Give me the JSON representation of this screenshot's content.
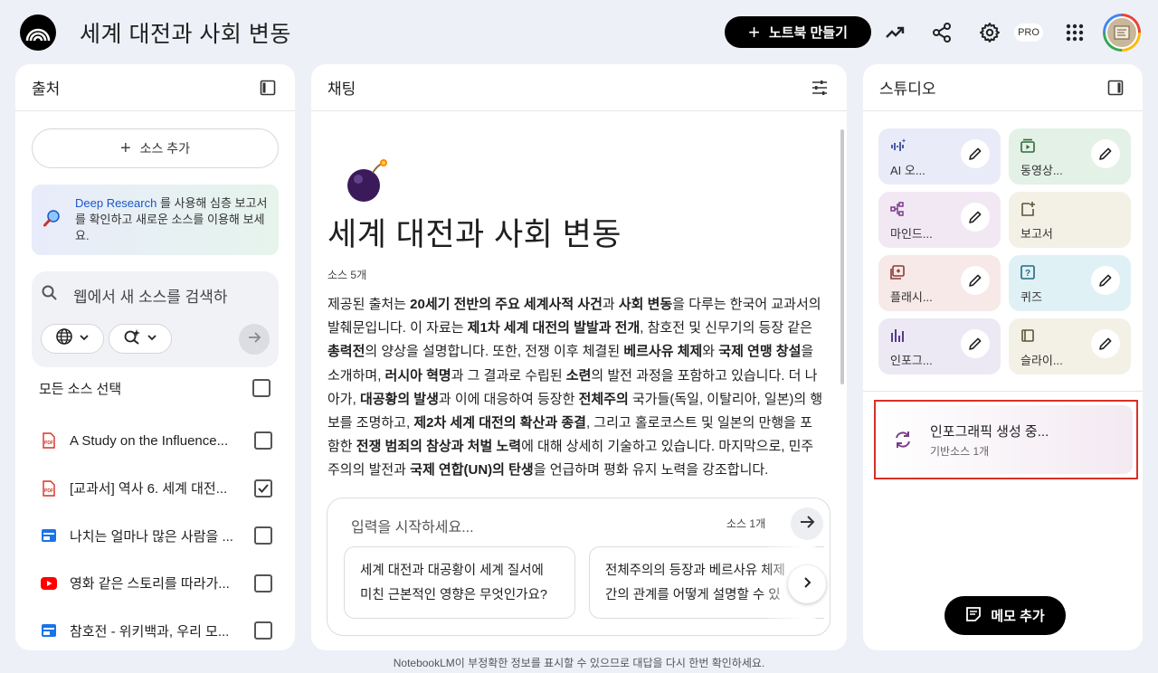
{
  "header": {
    "title": "세계 대전과 사회 변동",
    "create_notebook_label": "노트북 만들기",
    "pro_badge": "PRO"
  },
  "sources": {
    "title": "출처",
    "add_source_label": "소스 추가",
    "deep_research_link": "Deep Research",
    "deep_research_text": " 를 사용해 심층 보고서를 확인하고 새로운 소스를 이용해 보세요.",
    "search_placeholder": "웹에서 새 소스를 검색하",
    "select_all_label": "모든 소스 선택",
    "items": [
      {
        "label": "A Study on the Influence...",
        "type": "pdf",
        "checked": false
      },
      {
        "label": "[교과서] 역사 6. 세계 대전...",
        "type": "pdf",
        "checked": true
      },
      {
        "label": "나치는 얼마나 많은 사람을 ...",
        "type": "web",
        "checked": false
      },
      {
        "label": "영화 같은 스토리를 따라가...",
        "type": "youtube",
        "checked": false
      },
      {
        "label": "참호전 - 위키백과, 우리 모...",
        "type": "web",
        "checked": false
      }
    ]
  },
  "chat": {
    "title": "채팅",
    "notebook_title": "세계 대전과 사회 변동",
    "source_count": "소스 5개",
    "summary_segments": [
      {
        "t": "제공된 출처는 ",
        "b": false
      },
      {
        "t": "20세기 전반의 주요 세계사적 사건",
        "b": true
      },
      {
        "t": "과 ",
        "b": false
      },
      {
        "t": "사회 변동",
        "b": true
      },
      {
        "t": "을 다루는 한국어 교과서의 발췌문입니다. 이 자료는 ",
        "b": false
      },
      {
        "t": "제1차 세계 대전의 발발과 전개",
        "b": true
      },
      {
        "t": ", 참호전 및 신무기의 등장 같은 ",
        "b": false
      },
      {
        "t": "총력전",
        "b": true
      },
      {
        "t": "의 양상을 설명합니다. 또한, 전쟁 이후 체결된 ",
        "b": false
      },
      {
        "t": "베르사유 체제",
        "b": true
      },
      {
        "t": "와 ",
        "b": false
      },
      {
        "t": "국제 연맹 창설",
        "b": true
      },
      {
        "t": "을 소개하며, ",
        "b": false
      },
      {
        "t": "러시아 혁명",
        "b": true
      },
      {
        "t": "과 그 결과로 수립된 ",
        "b": false
      },
      {
        "t": "소련",
        "b": true
      },
      {
        "t": "의 발전 과정을 포함하고 있습니다. 더 나아가, ",
        "b": false
      },
      {
        "t": "대공황의 발생",
        "b": true
      },
      {
        "t": "과 이에 대응하여 등장한 ",
        "b": false
      },
      {
        "t": "전체주의",
        "b": true
      },
      {
        "t": " 국가들(독일, 이탈리아, 일본)의 행보를 조명하고, ",
        "b": false
      },
      {
        "t": "제2차 세계 대전의 확산과 종결",
        "b": true
      },
      {
        "t": ", 그리고 홀로코스트 및 일본의 만행을 포함한 ",
        "b": false
      },
      {
        "t": "전쟁 범죄의 참상과 처벌 노력",
        "b": true
      },
      {
        "t": "에 대해 상세히 기술하고 있습니다. 마지막으로, 민주주의의 발전과 ",
        "b": false
      },
      {
        "t": "국제 연합(UN)의 탄생",
        "b": true
      },
      {
        "t": "을 언급하며 평화 유지 노력을 강조합니다.",
        "b": false
      }
    ],
    "input_placeholder": "입력을 시작하세요...",
    "input_source_count": "소스 1개",
    "suggestions": [
      {
        "line1": "세계 대전과 대공황이 세계 질서에",
        "line2": "미친 근본적인 영향은 무엇인가요?"
      },
      {
        "line1": "전체주의의 등장과 베르사유 체제",
        "line2": "간의 관계를 어떻게 설명할 수 있"
      }
    ]
  },
  "studio": {
    "title": "스튜디오",
    "tiles": [
      {
        "label": "AI 오...",
        "icon": "audio-icon",
        "color": "#e9ebf8",
        "icon_color": "#3a4a9a"
      },
      {
        "label": "동영상...",
        "icon": "video-icon",
        "color": "#e3f1e7",
        "icon_color": "#2f6a3c"
      },
      {
        "label": "마인드...",
        "icon": "mindmap-icon",
        "color": "#f1e8f4",
        "icon_color": "#7a3c8a"
      },
      {
        "label": "보고서",
        "icon": "report-icon",
        "color": "#f3f1e6",
        "icon_color": "#5b5537"
      },
      {
        "label": "플래시...",
        "icon": "flashcard-icon",
        "color": "#f6e9e8",
        "icon_color": "#8a3a33"
      },
      {
        "label": "퀴즈",
        "icon": "quiz-icon",
        "color": "#e0f1f6",
        "icon_color": "#1f6a80"
      },
      {
        "label": "인포그...",
        "icon": "infographic-icon",
        "color": "#ece9f5",
        "icon_color": "#5a3a8a"
      },
      {
        "label": "슬라이...",
        "icon": "slides-icon",
        "color": "#f3f1e6",
        "icon_color": "#5b5537"
      }
    ],
    "generating_title": "인포그래픽 생성 중...",
    "generating_sub": "기반소스 1개",
    "add_memo_label": "메모 추가"
  },
  "footer": {
    "disclaimer": "NotebookLM이 부정확한 정보를 표시할 수 있으므로 대답을 다시 한번 확인하세요."
  }
}
